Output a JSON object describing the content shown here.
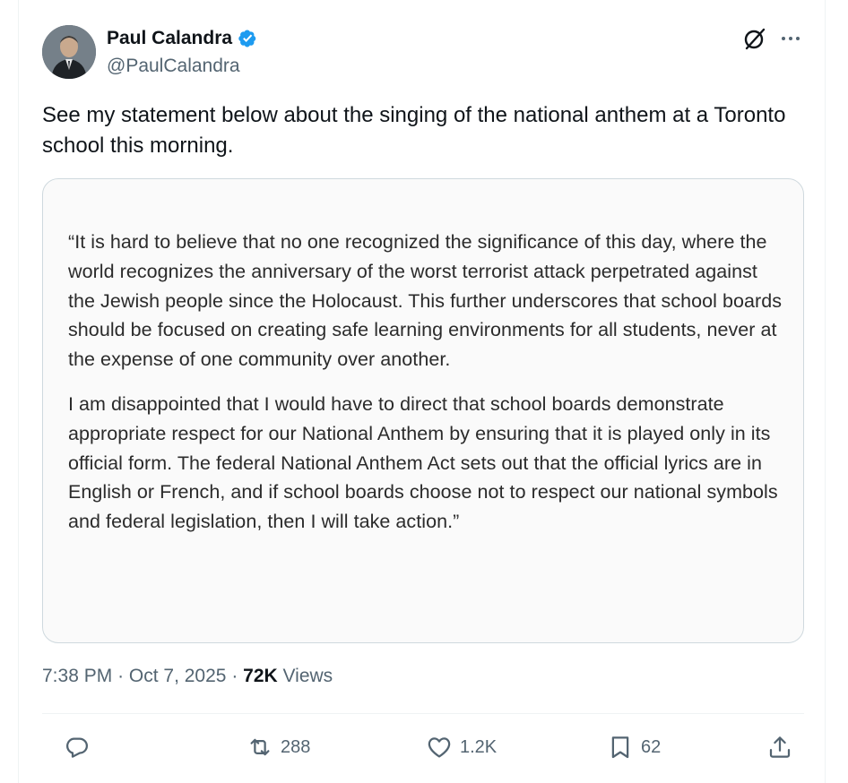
{
  "author": {
    "display_name": "Paul Calandra",
    "handle": "@PaulCalandra",
    "verified": true
  },
  "tweet": {
    "text": "See my statement below about the singing of the national anthem at a Toronto school this morning."
  },
  "media": {
    "paragraphs": [
      "“It is hard to believe that no one recognized the significance of this day, where the world recognizes the anniversary of the worst terrorist attack perpetrated against the Jewish people since the Holocaust. This further underscores that school boards should be focused on creating safe learning environments for all students, never at the expense of one community over another.",
      "I am disappointed that I would have to direct that school boards demonstrate appropriate respect for our National Anthem by ensuring that it is played only in its official form. The federal National Anthem Act sets out that the official lyrics are in English or French, and if school boards choose not to respect our national symbols and federal legislation, then I will take action.”"
    ]
  },
  "meta": {
    "time": "7:38 PM",
    "separator": "·",
    "date": "Oct 7, 2025",
    "views_count": "72K",
    "views_label": "Views"
  },
  "actions": {
    "reply_count": "",
    "retweet_count": "288",
    "like_count": "1.2K",
    "bookmark_count": "62"
  },
  "colors": {
    "verified_blue": "#1d9bf0",
    "secondary_text": "#536471",
    "primary_text": "#0f1419",
    "border": "#cfd9de"
  },
  "icons": [
    "verified-badge-icon",
    "grok-icon",
    "more-icon",
    "reply-icon",
    "retweet-icon",
    "like-icon",
    "bookmark-icon",
    "share-icon"
  ]
}
